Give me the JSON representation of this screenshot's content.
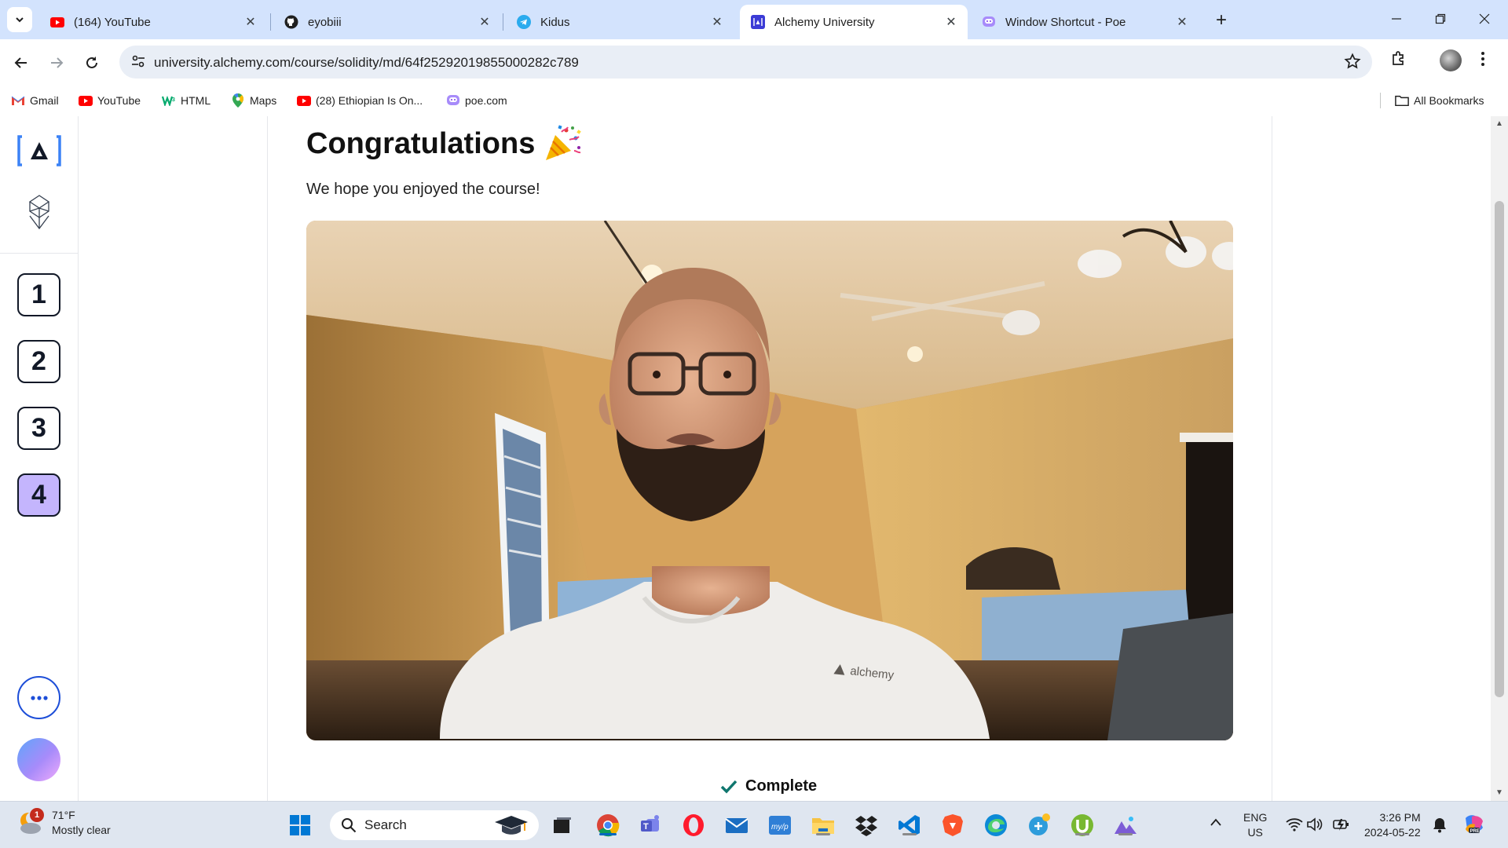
{
  "browser": {
    "tabs": [
      {
        "title": "(164) YouTube",
        "icon": "youtube-icon"
      },
      {
        "title": "eyobiii",
        "icon": "github-icon"
      },
      {
        "title": "Kidus",
        "icon": "telegram-icon"
      },
      {
        "title": "Alchemy University",
        "icon": "alchemy-icon",
        "active": true
      },
      {
        "title": "Window Shortcut - Poe",
        "icon": "poe-icon"
      }
    ],
    "url": "university.alchemy.com/course/solidity/md/64f25292019855000282c789",
    "bookmarks": [
      {
        "label": "Gmail",
        "icon": "gmail-icon"
      },
      {
        "label": "YouTube",
        "icon": "youtube-icon"
      },
      {
        "label": "HTML",
        "icon": "w3schools-icon"
      },
      {
        "label": "Maps",
        "icon": "maps-pin-icon"
      },
      {
        "label": "(28) Ethiopian Is On...",
        "icon": "youtube-icon"
      },
      {
        "label": "poe.com",
        "icon": "poe-icon"
      }
    ],
    "all_bookmarks": "All Bookmarks"
  },
  "sidebar": {
    "modules": [
      "1",
      "2",
      "3",
      "4"
    ],
    "active_module": "4"
  },
  "main": {
    "heading": "Congratulations",
    "heading_emoji": "party-popper-icon",
    "subtext": "We hope you enjoyed the course!",
    "video_shirt_logo": "alchemy",
    "complete_label": "Complete"
  },
  "taskbar": {
    "weather_temp": "71°F",
    "weather_desc": "Mostly clear",
    "weather_badge": "1",
    "search_label": "Search",
    "lang_line1": "ENG",
    "lang_line2": "US",
    "time": "3:26 PM",
    "date": "2024-05-22"
  },
  "colors": {
    "tabbar": "#d3e3fd",
    "active_module": "#c4b5fd",
    "complete_check": "#0f766e",
    "accent_blue": "#1d4ed8"
  }
}
